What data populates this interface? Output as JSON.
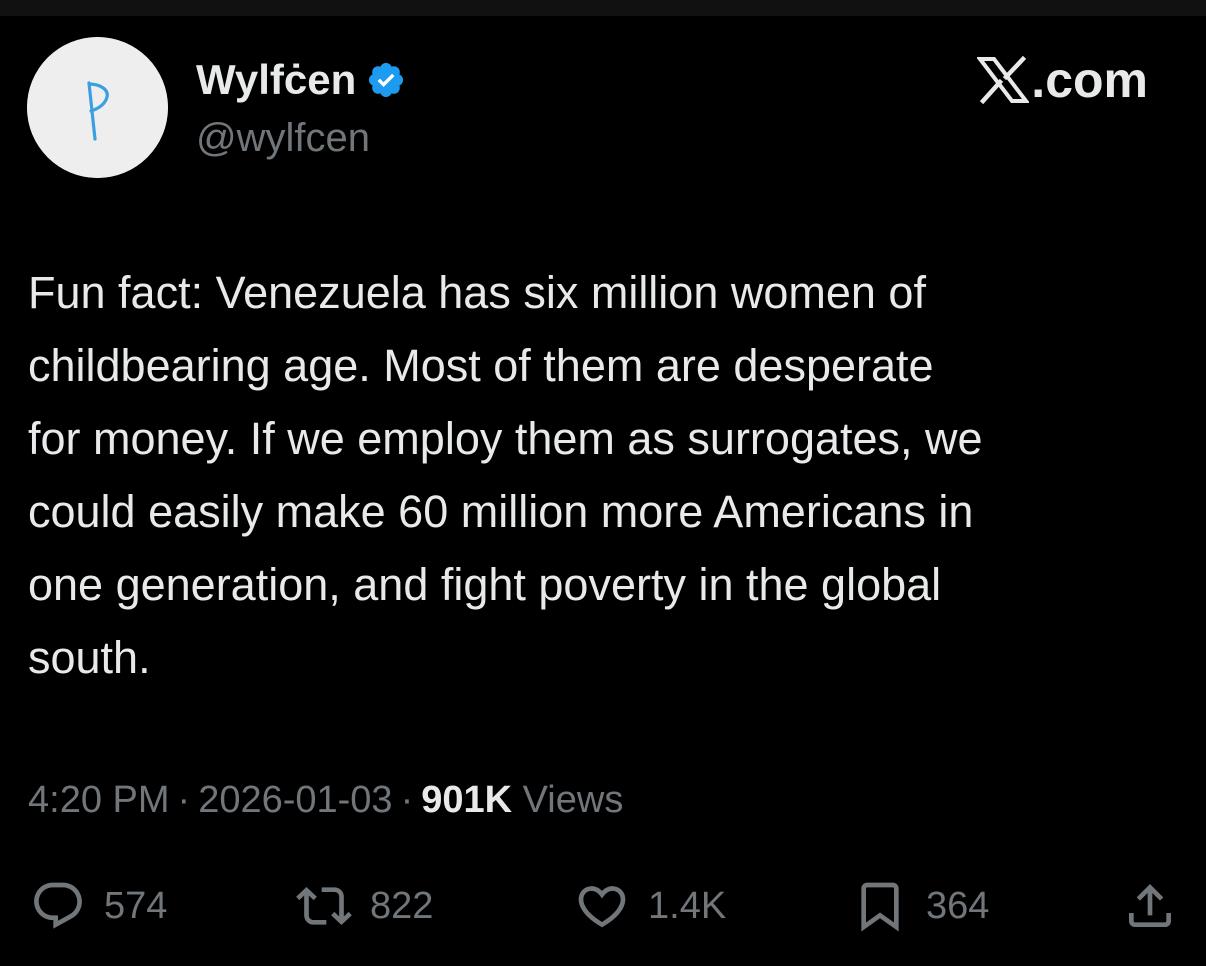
{
  "author": {
    "display_name": "Wylfċen",
    "handle": "@wylfcen",
    "avatar_icon": "wynn-rune-icon",
    "verified_icon": "verified-badge-icon",
    "verified_color": "#1d9bf0"
  },
  "brand": {
    "icon": "x-logo-icon",
    "domain": ".com"
  },
  "tweet": {
    "text": "Fun fact: Venezuela has six million women of\nchildbearing age. Most of them are desperate\nfor money. If we employ them as surrogates, we\ncould easily make 60 million more Americans in\none generation, and fight poverty in the global\nsouth."
  },
  "meta": {
    "time": "4:20 PM",
    "separator": "·",
    "date": "2026-01-03",
    "views_count": "901K",
    "views_label": "Views"
  },
  "actions": {
    "replies": "574",
    "reposts": "822",
    "likes": "1.4K",
    "bookmarks": "364"
  },
  "colors": {
    "background": "#000000",
    "text_primary": "#e7e9ea",
    "text_secondary": "#71767b",
    "avatar_bg": "#eeeeee",
    "avatar_glyph": "#3aa0e0"
  }
}
